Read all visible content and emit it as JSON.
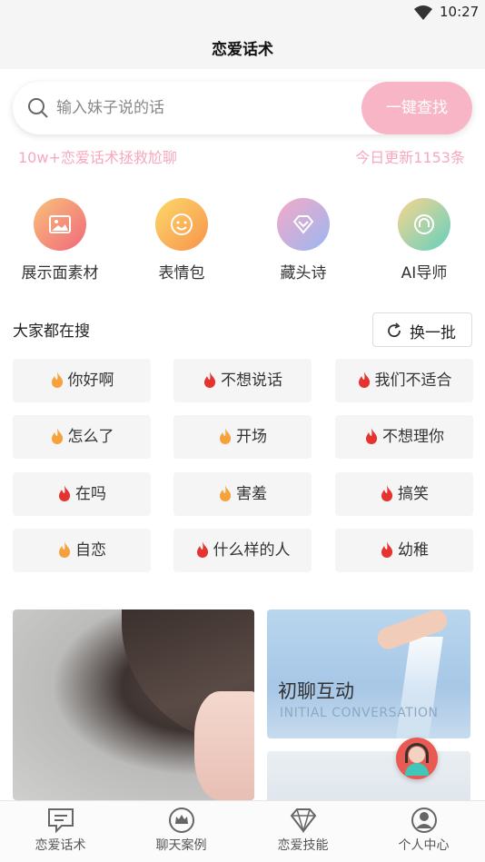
{
  "status_bar": {
    "time": "10:27"
  },
  "header": {
    "title": "恋爱话术"
  },
  "search": {
    "placeholder": "输入妹子说的话",
    "button_label": "一键查找"
  },
  "info": {
    "left_text": "10w+恋爱话术拯救尬聊",
    "right_text": "今日更新1153条"
  },
  "features": [
    {
      "label": "展示面素材",
      "icon": "image-icon"
    },
    {
      "label": "表情包",
      "icon": "smiley-icon"
    },
    {
      "label": "藏头诗",
      "icon": "diamond-icon"
    },
    {
      "label": "AI导师",
      "icon": "headset-icon"
    }
  ],
  "hot_search": {
    "title": "大家都在搜",
    "refresh_label": "换一批",
    "items": [
      {
        "label": "你好啊",
        "fire_color": "#f5a23d"
      },
      {
        "label": "不想说话",
        "fire_color": "#e5342f"
      },
      {
        "label": "我们不适合",
        "fire_color": "#e5342f"
      },
      {
        "label": "怎么了",
        "fire_color": "#f5a23d"
      },
      {
        "label": "开场",
        "fire_color": "#f5a23d"
      },
      {
        "label": "不想理你",
        "fire_color": "#e5342f"
      },
      {
        "label": "在吗",
        "fire_color": "#e5342f"
      },
      {
        "label": "害羞",
        "fire_color": "#f5a23d"
      },
      {
        "label": "搞笑",
        "fire_color": "#e5342f"
      },
      {
        "label": "自恋",
        "fire_color": "#f5a23d"
      },
      {
        "label": "什么样的人",
        "fire_color": "#e5342f"
      },
      {
        "label": "幼稚",
        "fire_color": "#e5342f"
      }
    ]
  },
  "banners": {
    "right_title": "初聊互动",
    "right_subtitle": "INITIAL CONVERSATION"
  },
  "tabbar": [
    {
      "label": "恋爱话术",
      "icon": "chat-icon"
    },
    {
      "label": "聊天案例",
      "icon": "crown-icon"
    },
    {
      "label": "恋爱技能",
      "icon": "diamond-icon"
    },
    {
      "label": "个人中心",
      "icon": "person-icon"
    }
  ],
  "colors": {
    "accent_pink": "#f8b5c6",
    "info_pink": "#f6a8bd"
  }
}
